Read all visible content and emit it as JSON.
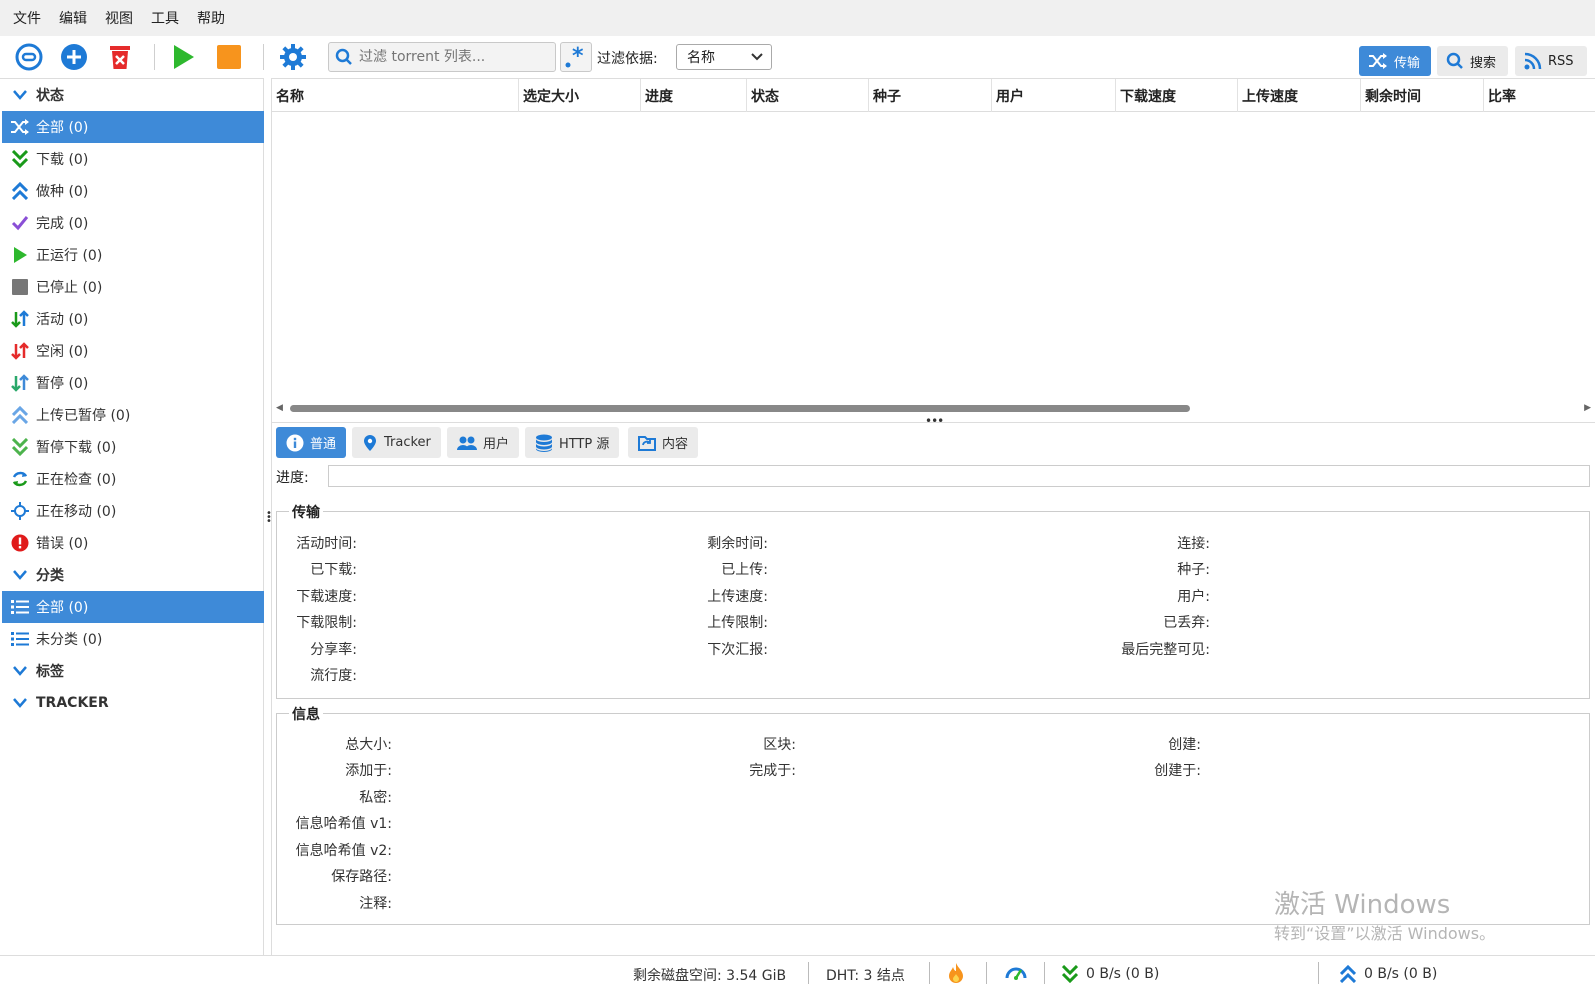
{
  "menu": [
    "文件",
    "编辑",
    "视图",
    "工具",
    "帮助"
  ],
  "toolbar": {
    "search_placeholder": "过滤 torrent 列表...",
    "filter_label": "过滤依据:",
    "filter_value": "名称",
    "tab_transfer": "传输",
    "tab_search": "搜索",
    "tab_rss": "RSS"
  },
  "sidebar": {
    "status_header": "状态",
    "status_items": [
      {
        "label": "全部 (0)",
        "icon": "shuffle-icon"
      },
      {
        "label": "下载 (0)",
        "icon": "double-chevron-down-icon"
      },
      {
        "label": "做种 (0)",
        "icon": "double-chevron-up-icon"
      },
      {
        "label": "完成 (0)",
        "icon": "check-icon"
      },
      {
        "label": "正运行 (0)",
        "icon": "play-icon"
      },
      {
        "label": "已停止 (0)",
        "icon": "stop-icon"
      },
      {
        "label": "活动 (0)",
        "icon": "updown-arrows-icon"
      },
      {
        "label": "空闲 (0)",
        "icon": "updown-arrows-red-icon"
      },
      {
        "label": "暂停 (0)",
        "icon": "updown-arrows-icon"
      },
      {
        "label": "上传已暂停 (0)",
        "icon": "double-chevron-up-icon"
      },
      {
        "label": "暂停下载 (0)",
        "icon": "double-chevron-down-icon"
      },
      {
        "label": "正在检查 (0)",
        "icon": "refresh-icon"
      },
      {
        "label": "正在移动 (0)",
        "icon": "move-icon"
      },
      {
        "label": "错误 (0)",
        "icon": "error-icon"
      }
    ],
    "category_header": "分类",
    "category_items": [
      {
        "label": "全部 (0)",
        "icon": "list-icon"
      },
      {
        "label": "未分类 (0)",
        "icon": "list-icon"
      }
    ],
    "tags_header": "标签",
    "tracker_header": "TRACKER"
  },
  "table": {
    "columns": [
      "名称",
      "选定大小",
      "进度",
      "状态",
      "种子",
      "用户",
      "下载速度",
      "上传速度",
      "剩余时间",
      "比率"
    ]
  },
  "details": {
    "tabs": [
      "普通",
      "Tracker",
      "用户",
      "HTTP 源",
      "内容"
    ],
    "progress_label": "进度:",
    "transfer_legend": "传输",
    "transfer_col1": [
      "活动时间:",
      "已下载:",
      "下载速度:",
      "下载限制:",
      "分享率:",
      "流行度:"
    ],
    "transfer_col2": [
      "剩余时间:",
      "已上传:",
      "上传速度:",
      "上传限制:",
      "下次汇报:"
    ],
    "transfer_col3": [
      "连接:",
      "种子:",
      "用户:",
      "已丢弃:",
      "最后完整可见:"
    ],
    "info_legend": "信息",
    "info_col1": [
      "总大小:",
      "添加于:",
      "私密:",
      "信息哈希值 v1:",
      "信息哈希值 v2:",
      "保存路径:",
      "注释:"
    ],
    "info_col2": [
      "区块:",
      "完成于:"
    ],
    "info_col3": [
      "创建:",
      "创建于:"
    ]
  },
  "statusbar": {
    "disk_space": "剩余磁盘空间: 3.54 GiB",
    "dht": "DHT: 3 结点",
    "download": "0 B/s (0 B)",
    "upload": "0 B/s (0 B)"
  },
  "watermark": {
    "line1": "激活 Windows",
    "line2": "转到“设置”以激活 Windows。"
  },
  "colors": {
    "accent": "#3e8ad8",
    "green": "#2eb82e",
    "orange": "#f7941d",
    "red": "#e52b2b"
  }
}
